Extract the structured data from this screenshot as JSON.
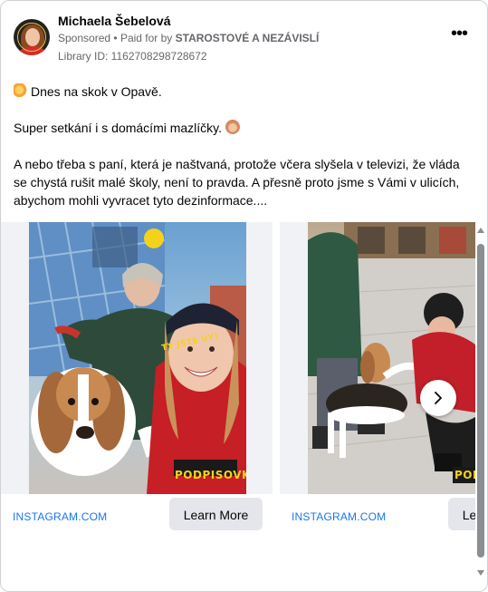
{
  "advertiser": {
    "name": "Michaela Šebelová",
    "sponsored": "Sponsored",
    "paid_for_prefix": "Paid for by",
    "funder": "STAROSTOVÉ A NEZÁVISLÍ",
    "library_id": "Library ID: 1162708298728672"
  },
  "post": {
    "line1": "Dnes na skok v Opavě.",
    "line2": "Super setkání i s domácími mazlíčky.",
    "paragraph3": "A nebo třeba s paní, která je naštvaná, protože včera slyšela v televizi, že vláda se chystá rušit malé školy, není to pravda. A přesně proto jsme s Vámi v ulicích, abychom mohli vyvracet tyto dezinformace...."
  },
  "carousel": {
    "cards": [
      {
        "link": "INSTAGRAM.COM",
        "button": "Learn More",
        "overlay_text": "PODPISOVKA",
        "cap_text": "TY JSTE VY!"
      },
      {
        "link": "INSTAGRAM.COM",
        "button": "Learn More",
        "overlay_text": "PODPISOVKA"
      }
    ]
  },
  "icons": [
    "more-options-icon",
    "chevron-right-icon",
    "sparkle-emoji-icon",
    "dog-emoji-icon"
  ],
  "colors": {
    "link": "#1877f2",
    "text": "#050505",
    "secondary": "#65676b",
    "button_bg": "#e4e6eb"
  }
}
